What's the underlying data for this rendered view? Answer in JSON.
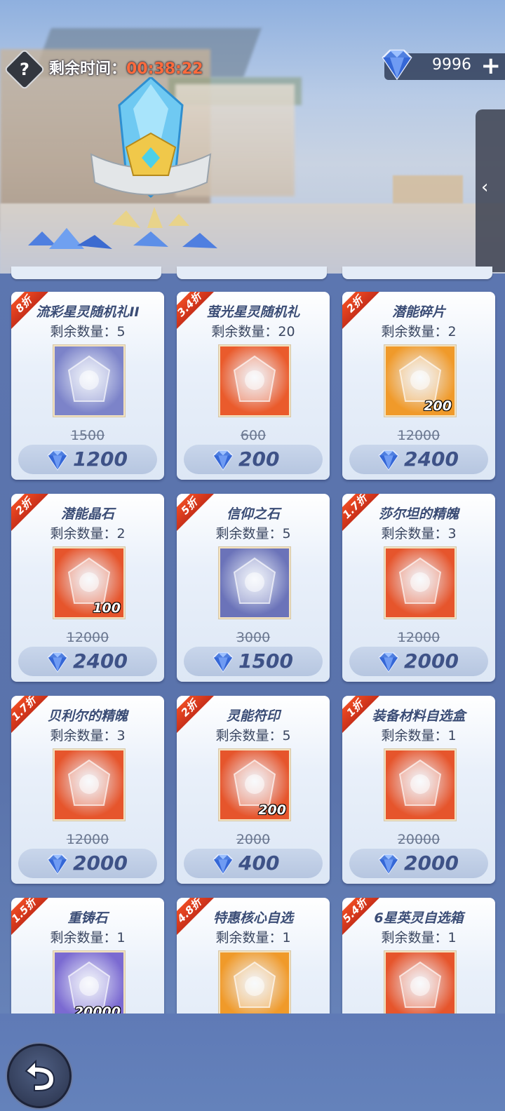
{
  "header": {
    "help_icon": "question-icon",
    "timer_label": "剩余时间：",
    "timer_value": "00:38:22",
    "gem_balance": "9996",
    "plus": "+",
    "side_tab_arrow": "‹",
    "gem_color": "#4f7fe0"
  },
  "items": [
    {
      "discount": "8折",
      "name": "流彩星灵随机礼II",
      "qty": "剩余数量：5",
      "orig": "1500",
      "price": "1200",
      "count": "",
      "icon": "prismatic-chest-icon",
      "bg": "#7c83c9"
    },
    {
      "discount": "3.4折",
      "name": "萤光星灵随机礼",
      "qty": "剩余数量：20",
      "orig": "600",
      "price": "200",
      "count": "",
      "icon": "orange-chest-icon",
      "bg": "#ea5b2c"
    },
    {
      "discount": "2折",
      "name": "潜能碎片",
      "qty": "剩余数量：2",
      "orig": "12000",
      "price": "2400",
      "count": "200",
      "icon": "potential-shard-icon",
      "bg": "#f09a2a"
    },
    {
      "discount": "2折",
      "name": "潜能晶石",
      "qty": "剩余数量：2",
      "orig": "12000",
      "price": "2400",
      "count": "100",
      "icon": "potential-crystal-icon",
      "bg": "#e6552c"
    },
    {
      "discount": "5折",
      "name": "信仰之石",
      "qty": "剩余数量：5",
      "orig": "3000",
      "price": "1500",
      "count": "",
      "icon": "faith-stone-icon",
      "bg": "#6b73b9"
    },
    {
      "discount": "1.7折",
      "name": "莎尔坦的精魄",
      "qty": "剩余数量：3",
      "orig": "12000",
      "price": "2000",
      "count": "",
      "icon": "dark-orb-icon",
      "bg": "#e6552c"
    },
    {
      "discount": "1.7折",
      "name": "贝利尔的精魄",
      "qty": "剩余数量：3",
      "orig": "12000",
      "price": "2000",
      "count": "",
      "icon": "red-orb-icon",
      "bg": "#e6552c"
    },
    {
      "discount": "2折",
      "name": "灵能符印",
      "qty": "剩余数量：5",
      "orig": "2000",
      "price": "400",
      "count": "200",
      "icon": "psionic-seal-icon",
      "bg": "#e6552c"
    },
    {
      "discount": "1折",
      "name": "装备材料自选盒",
      "qty": "剩余数量：1",
      "orig": "20000",
      "price": "2000",
      "count": "",
      "icon": "armor-box-icon",
      "bg": "#e6552c"
    },
    {
      "discount": "1.5折",
      "name": "重铸石",
      "qty": "剩余数量：1",
      "orig": "",
      "price": "",
      "count": "20000",
      "icon": "reforge-stone-icon",
      "bg": "#7b6ad1"
    },
    {
      "discount": "4.8折",
      "name": "特惠核心自选",
      "qty": "剩余数量：1",
      "orig": "",
      "price": "",
      "count": "",
      "icon": "core-card-icon",
      "bg": "#f09a2a"
    },
    {
      "discount": "5.4折",
      "name": "6星英灵自选箱",
      "qty": "剩余数量：1",
      "orig": "",
      "price": "",
      "count": "",
      "icon": "hero-helmet-icon",
      "bg": "#e6552c"
    }
  ],
  "footer": {
    "back_icon": "back-arrow-icon"
  }
}
